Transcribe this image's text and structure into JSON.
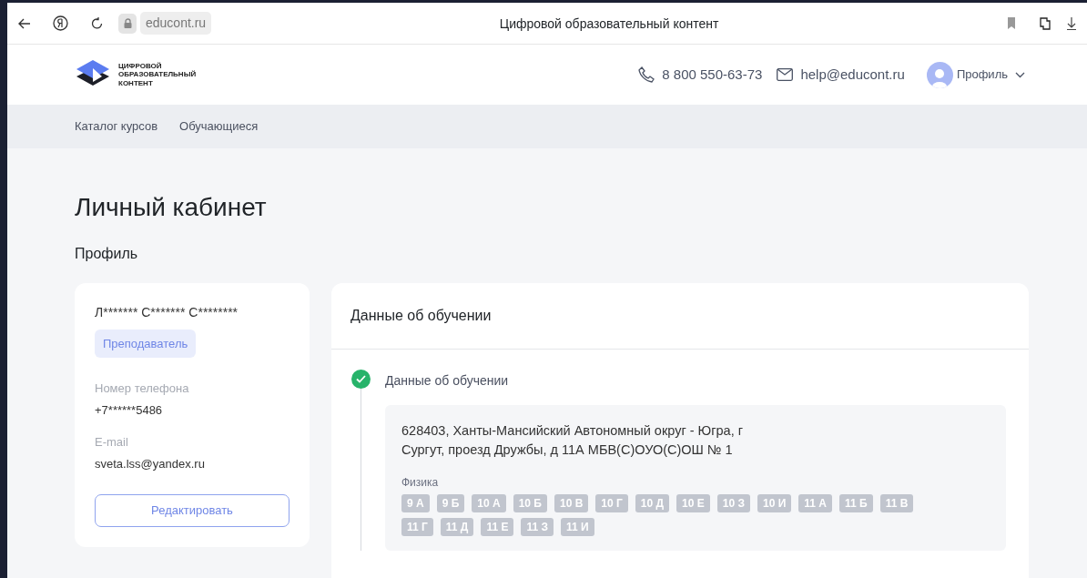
{
  "browser": {
    "address": "educont.ru",
    "title": "Цифровой образовательный контент"
  },
  "header": {
    "logo_lines": [
      "ЦИФРОВОЙ",
      "ОБРАЗОВАТЕЛЬНЫЙ",
      "КОНТЕНТ"
    ],
    "phone": "8 800 550-63-73",
    "email": "help@educont.ru",
    "profile": "Профиль"
  },
  "nav": [
    "Каталог курсов",
    "Обучающиеся"
  ],
  "page_title": "Личный кабинет",
  "section_title": "Профиль",
  "profile": {
    "name": "Л******* С******* С********",
    "role": "Преподаватель",
    "fields": [
      {
        "label": "Номер телефона",
        "value": "+7******5486"
      },
      {
        "label": "E-mail",
        "value": "sveta.lss@yandex.ru"
      }
    ],
    "edit_button": "Редактировать"
  },
  "education": {
    "title": "Данные об обучении",
    "steps": [
      {
        "title": "Данные об обучении",
        "done": true,
        "address": "628403, Ханты-Мансийский Автономный округ - Югра, г Сургут, проезд Дружбы, д 11А МБВ(С)ОУО(С)ОШ № 1",
        "subject": "Физика",
        "classes": [
          "9 А",
          "9 Б",
          "10 А",
          "10 Б",
          "10 В",
          "10 Г",
          "10 Д",
          "10 Е",
          "10 З",
          "10 И",
          "11 А",
          "11 Б",
          "11 В",
          "11 Г",
          "11 Д",
          "11 Е",
          "11 З",
          "11 И"
        ]
      }
    ]
  }
}
